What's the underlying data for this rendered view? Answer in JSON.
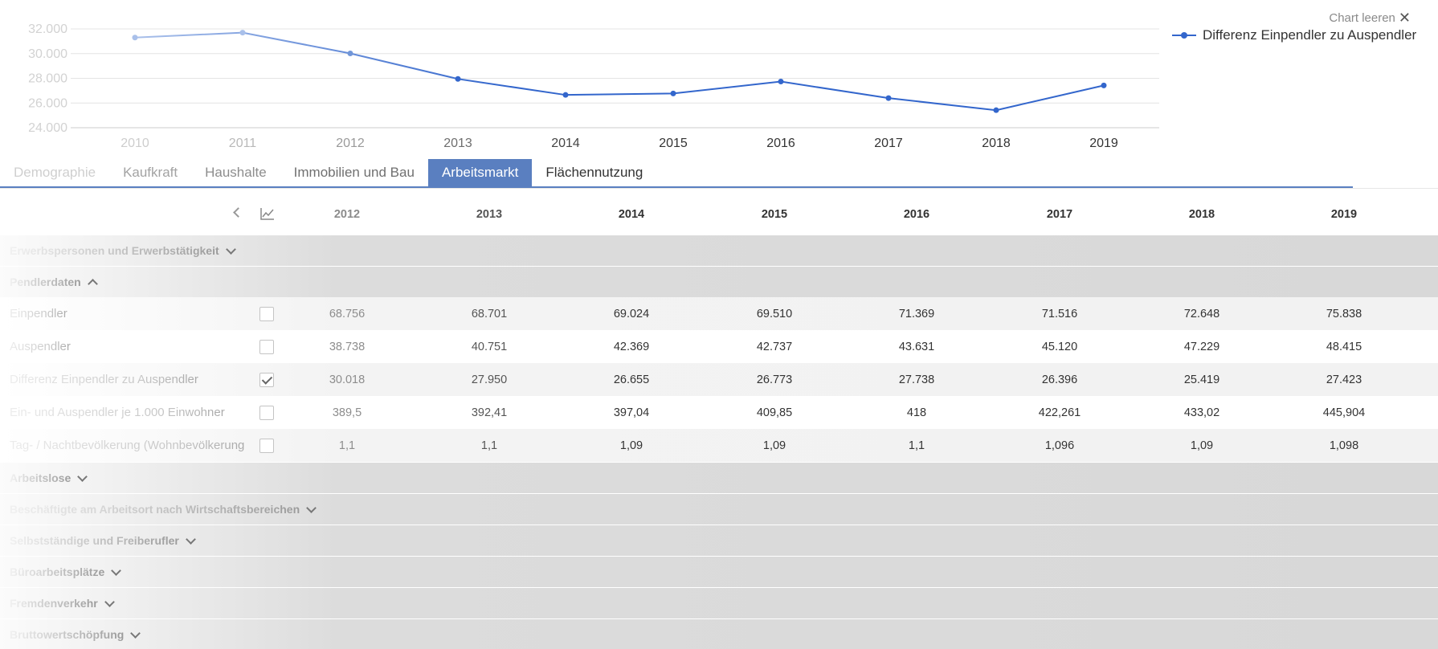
{
  "chart": {
    "clear_label": "Chart leeren",
    "clear_icon": "close-icon",
    "legend_label": "Differenz Einpendler zu Auspendler",
    "line_color": "#3366cc"
  },
  "chart_data": {
    "type": "line",
    "x": [
      "2010",
      "2011",
      "2012",
      "2013",
      "2014",
      "2015",
      "2016",
      "2017",
      "2018",
      "2019"
    ],
    "series": [
      {
        "name": "Differenz Einpendler zu Auspendler",
        "values": [
          31300,
          31700,
          30018,
          27950,
          26655,
          26773,
          27738,
          26396,
          25419,
          27423
        ]
      }
    ],
    "y_ticks": [
      "32.000",
      "30.000",
      "28.000",
      "26.000",
      "24.000"
    ],
    "y_tick_values": [
      32000,
      30000,
      28000,
      26000,
      24000
    ],
    "ylim": [
      24000,
      32000
    ],
    "grid": true,
    "legend": "top-right"
  },
  "tabs": [
    {
      "label": "Demographie",
      "state": "faded1"
    },
    {
      "label": "Kaufkraft",
      "state": "faded2"
    },
    {
      "label": "Haushalte",
      "state": "faded3"
    },
    {
      "label": "Immobilien und Bau",
      "state": "faded4"
    },
    {
      "label": "Arbeitsmarkt",
      "state": "active"
    },
    {
      "label": "Flächennutzung",
      "state": "plain"
    }
  ],
  "table": {
    "years": [
      "2012",
      "2013",
      "2014",
      "2015",
      "2016",
      "2017",
      "2018",
      "2019"
    ],
    "sections_top": [
      {
        "label": "Erwerbspersonen und Erwerbstätigkeit",
        "expanded": false
      },
      {
        "label": "Pendlerdaten",
        "expanded": true
      }
    ],
    "rows": [
      {
        "label": "Einpendler",
        "checked": false,
        "values": [
          "68.756",
          "68.701",
          "69.024",
          "69.510",
          "71.369",
          "71.516",
          "72.648",
          "75.838"
        ]
      },
      {
        "label": "Auspendler",
        "checked": false,
        "values": [
          "38.738",
          "40.751",
          "42.369",
          "42.737",
          "43.631",
          "45.120",
          "47.229",
          "48.415"
        ]
      },
      {
        "label": "Differenz Einpendler zu Auspendler",
        "checked": true,
        "values": [
          "30.018",
          "27.950",
          "26.655",
          "26.773",
          "27.738",
          "26.396",
          "25.419",
          "27.423"
        ]
      },
      {
        "label": "Ein- und Auspendler je 1.000 Einwohner",
        "checked": false,
        "values": [
          "389,5",
          "392,41",
          "397,04",
          "409,85",
          "418",
          "422,261",
          "433,02",
          "445,904"
        ]
      },
      {
        "label": "Tag- / Nachtbevölkerung (Wohnbevölkerung",
        "checked": false,
        "values": [
          "1,1",
          "1,1",
          "1,09",
          "1,09",
          "1,1",
          "1,096",
          "1,09",
          "1,098"
        ]
      }
    ],
    "sections_bottom": [
      {
        "label": "Arbeitslose",
        "expanded": false
      },
      {
        "label": "Beschäftigte am Arbeitsort nach Wirtschaftsbereichen",
        "expanded": false
      },
      {
        "label": "Selbstständige und Freiberufler",
        "expanded": false
      },
      {
        "label": "Büroarbeitsplätze",
        "expanded": false
      },
      {
        "label": "Fremdenverkehr",
        "expanded": false
      },
      {
        "label": "Bruttowertschöpfung",
        "expanded": false
      }
    ]
  }
}
